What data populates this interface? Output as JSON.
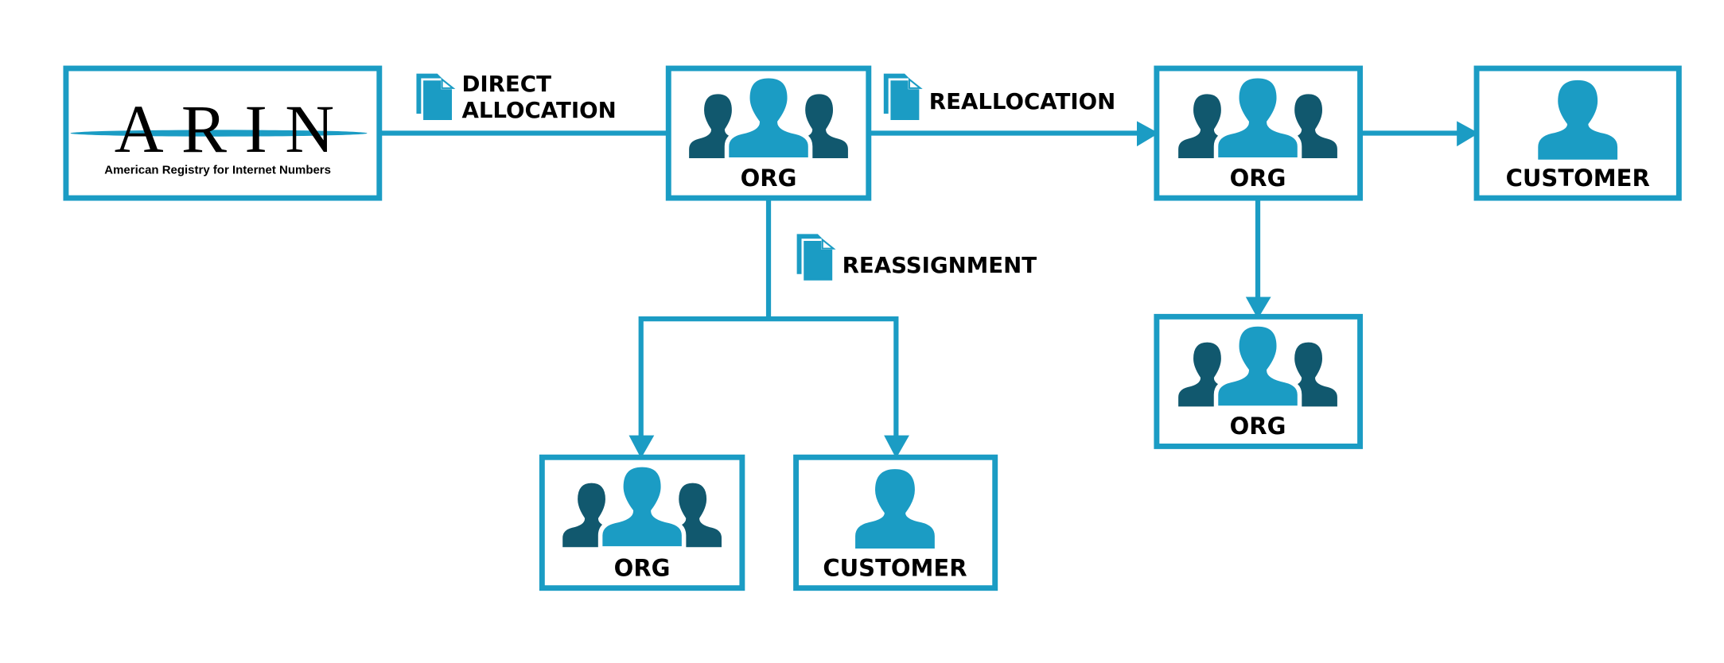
{
  "colors": {
    "accent": "#1b9cc4",
    "dark_person": "#11586e",
    "text": "#000000"
  },
  "logo": {
    "name": "ARIN",
    "subtitle": "American Registry for Internet Numbers"
  },
  "edges": {
    "direct_allocation": {
      "line1": "DIRECT",
      "line2": "ALLOCATION",
      "icon": "document-icon"
    },
    "reallocation": {
      "label": "REALLOCATION",
      "icon": "document-icon"
    },
    "reassignment": {
      "label": "REASSIGNMENT",
      "icon": "document-icon"
    }
  },
  "nodes": {
    "org_main": {
      "label": "ORG",
      "icon": "people-group-icon"
    },
    "org_realloc": {
      "label": "ORG",
      "icon": "people-group-icon"
    },
    "customer_realloc": {
      "label": "CUSTOMER",
      "icon": "person-icon"
    },
    "org_sub_realloc": {
      "label": "ORG",
      "icon": "people-group-icon"
    },
    "org_reassign": {
      "label": "ORG",
      "icon": "people-group-icon"
    },
    "customer_reassign": {
      "label": "CUSTOMER",
      "icon": "person-icon"
    }
  }
}
